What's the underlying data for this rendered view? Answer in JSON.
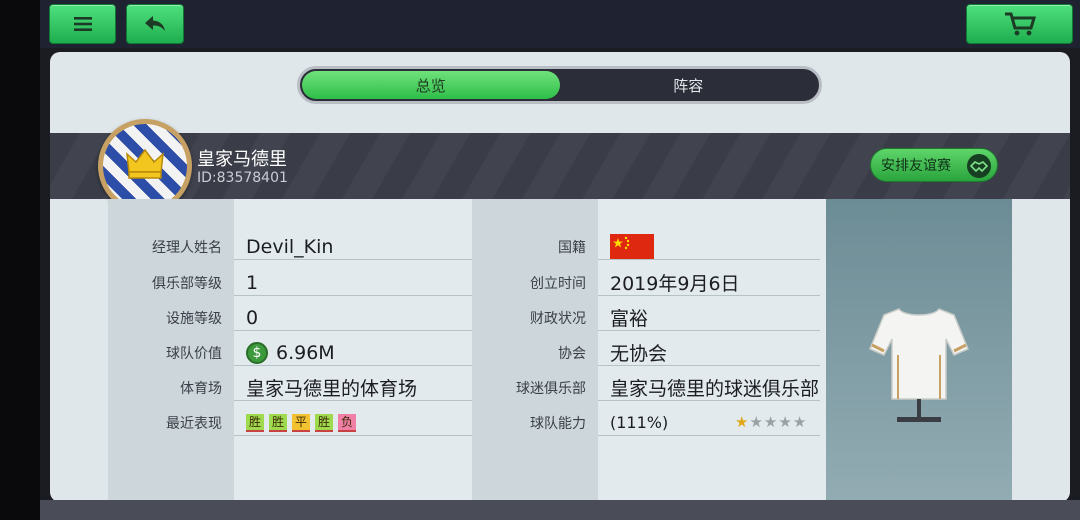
{
  "tabs": {
    "overview": "总览",
    "lineup": "阵容"
  },
  "club": {
    "name": "皇家马德里",
    "id": "ID:83578401"
  },
  "friendly_button": "安排友谊赛",
  "left": [
    {
      "label": "经理人姓名",
      "value": "Devil_Kin"
    },
    {
      "label": "俱乐部等级",
      "value": "1"
    },
    {
      "label": "设施等级",
      "value": "0"
    },
    {
      "label": "球队价值",
      "value": "6.96M",
      "icon": "money-icon"
    },
    {
      "label": "体育场",
      "value": "皇家马德里的体育场"
    },
    {
      "label": "最近表现",
      "form": [
        "胜",
        "胜",
        "平",
        "胜",
        "负"
      ]
    }
  ],
  "right": [
    {
      "label": "国籍",
      "flag": "china-flag"
    },
    {
      "label": "创立时间",
      "value": "2019年9月6日"
    },
    {
      "label": "财政状况",
      "value": "富裕"
    },
    {
      "label": "协会",
      "value": "无协会"
    },
    {
      "label": "球迷俱乐部",
      "value": "皇家马德里的球迷俱乐部"
    },
    {
      "label": "球队能力",
      "value": "(111%)",
      "stars": {
        "filled": 1,
        "total": 5
      }
    }
  ],
  "icons": {
    "menu": "menu-icon",
    "back": "back-arrow-icon",
    "cart": "cart-icon",
    "kit": "jersey-icon"
  },
  "colors": {
    "accent_green": "#2fbe4a",
    "win": "#9ed94e",
    "draw": "#f2c230",
    "loss": "#f07ea5"
  }
}
